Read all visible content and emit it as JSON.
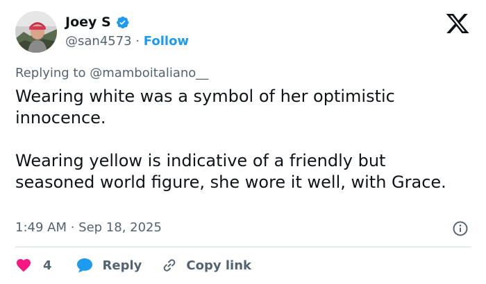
{
  "author": {
    "display_name": "Joey S",
    "handle": "@san4573",
    "separator": " · ",
    "follow_label": "Follow",
    "verified": true
  },
  "reply_context": {
    "prefix": "Replying to ",
    "mention": "@mamboitaliano__"
  },
  "tweet": {
    "paragraphs": [
      "Wearing white was a symbol of her optimistic innocence.",
      "Wearing yellow is indicative of a friendly but seasoned world figure, she wore it well, with Grace."
    ],
    "timestamp": "1:49 AM · Sep 18, 2025"
  },
  "actions": {
    "like_count": "4",
    "reply_label": "Reply",
    "copy_link_label": "Copy link"
  },
  "icons": {
    "brand": "x-logo-icon",
    "verified": "verified-badge-icon",
    "info": "info-icon",
    "like": "heart-icon",
    "reply": "speech-bubble-icon",
    "copy": "link-icon"
  },
  "colors": {
    "accent": "#1d9bf0",
    "like": "#f91880",
    "text_primary": "#0f1419",
    "text_secondary": "#536471",
    "divider": "#cfd9de"
  }
}
